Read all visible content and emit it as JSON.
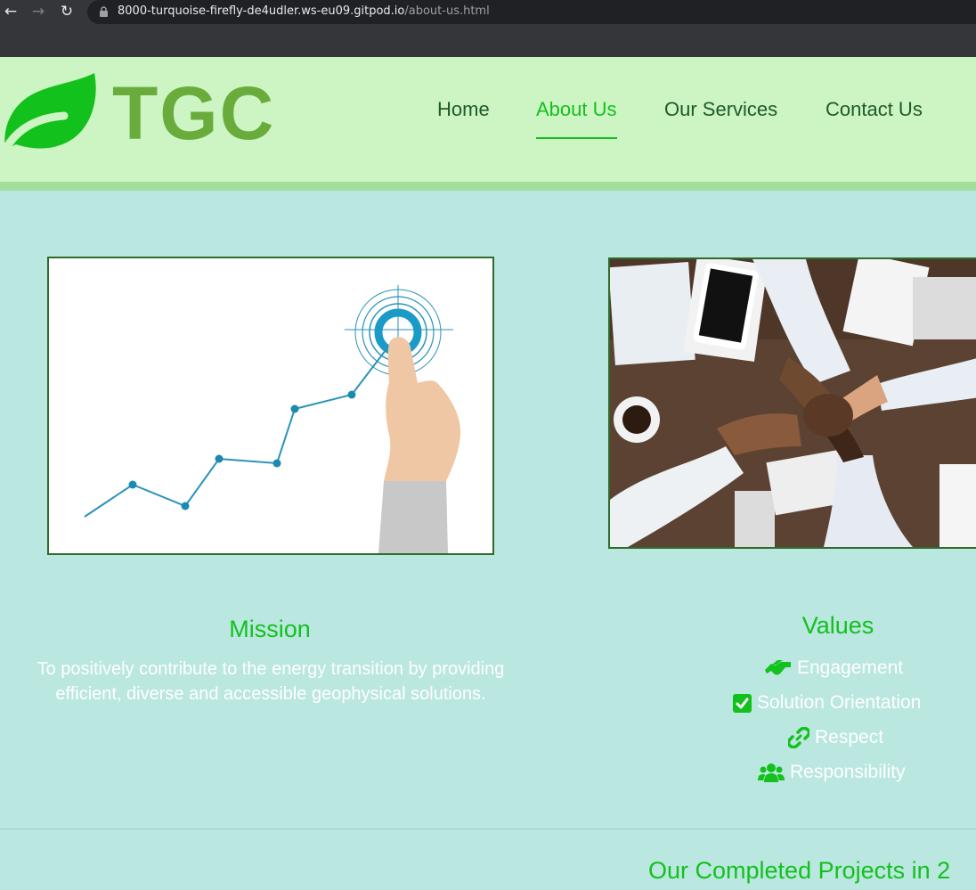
{
  "browser": {
    "back_icon": "arrow-left-icon",
    "forward_icon": "arrow-right-icon",
    "reload_icon": "reload-icon",
    "url_host": "8000-turquoise-firefly-de4udler.ws-eu09.gitpod.io",
    "url_path": "/about-us.html"
  },
  "header": {
    "logo_text": "TGC",
    "nav": [
      {
        "label": "Home",
        "active": false
      },
      {
        "label": "About Us",
        "active": true
      },
      {
        "label": "Our Services",
        "active": false
      },
      {
        "label": "Contact Us",
        "active": false
      }
    ]
  },
  "mission": {
    "title": "Mission",
    "text": "To positively contribute to the energy transition by providing efficient, diverse and accessible geophysical solutions."
  },
  "values": {
    "title": "Values",
    "items": [
      {
        "label": "Engagement",
        "icon": "handshake-icon"
      },
      {
        "label": "Solution Orientation",
        "icon": "check-square-icon"
      },
      {
        "label": "Respect",
        "icon": "link-icon"
      },
      {
        "label": "Responsibility",
        "icon": "users-icon"
      }
    ]
  },
  "projects": {
    "title": "Our Completed Projects in 2"
  },
  "colors": {
    "accent_green": "#13c11c",
    "header_bg": "#cdf5c3",
    "page_bg": "#bae7e0",
    "logo_green": "#6aac3c"
  }
}
